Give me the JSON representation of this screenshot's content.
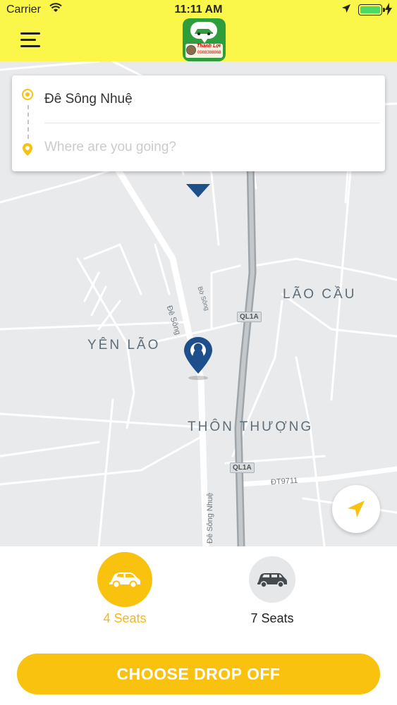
{
  "status_bar": {
    "carrier": "Carrier",
    "time": "11:11 AM",
    "icons": [
      "wifi-icon",
      "location-arrow-icon",
      "battery-icon",
      "charging-bolt-icon"
    ]
  },
  "header": {
    "menu_icon": "hamburger-menu-icon",
    "logo": {
      "brand_text": "Thành Lợi",
      "phone_text": "0988388868"
    },
    "background_color": "#fbf64a"
  },
  "route": {
    "origin": "Đê Sông Nhuệ",
    "destination_placeholder": "Where are you going?",
    "destination_value": ""
  },
  "map": {
    "areas": [
      "YÊN LÃO",
      "LÃO CẦU",
      "THÔN THƯỢNG"
    ],
    "roads": [
      "Đê Sông",
      "Bờ Sông",
      "Đê Sông Nhuệ",
      "ĐT9711"
    ],
    "shields": [
      "QL1A",
      "QL1A"
    ]
  },
  "vehicles": [
    {
      "label": "4 Seats",
      "selected": true,
      "icon": "car-4-seats-icon"
    },
    {
      "label": "7 Seats",
      "selected": false,
      "icon": "car-7-seats-icon"
    }
  ],
  "cta_label": "CHOOSE DROP OFF",
  "colors": {
    "accent": "#f9c20f",
    "header": "#fbf64a",
    "pin": "#1d4f8c",
    "map_bg": "#e9eaec"
  }
}
